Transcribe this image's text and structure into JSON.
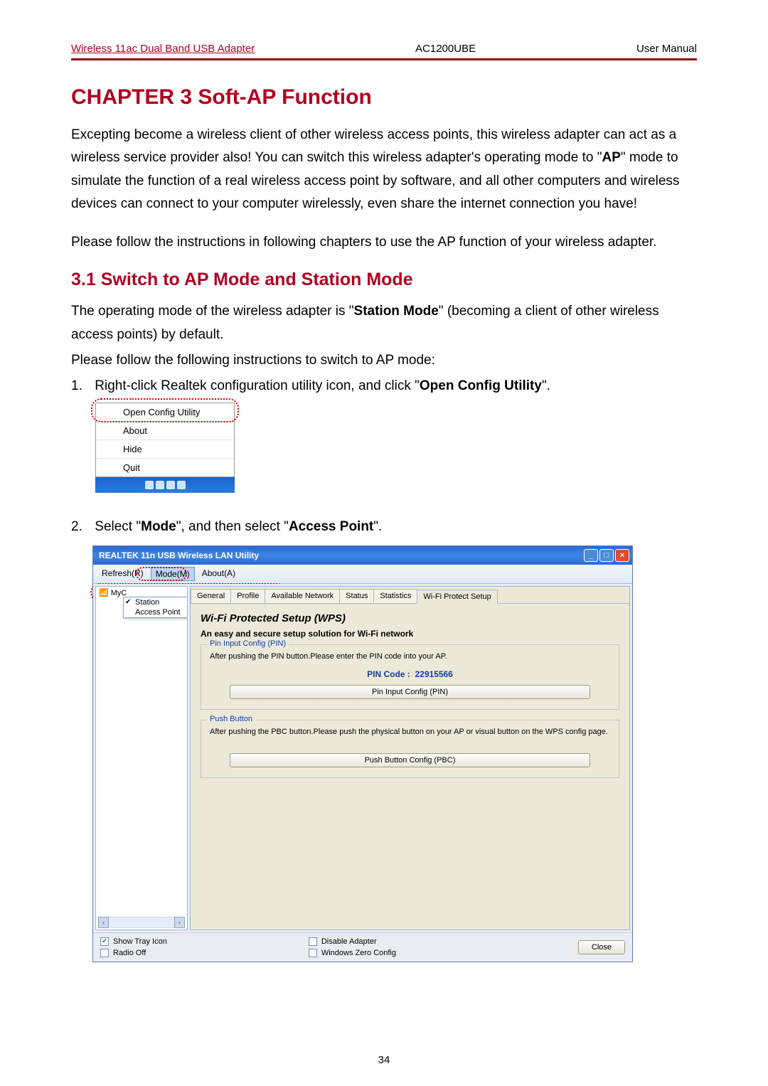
{
  "header": {
    "left": "Wireless 11ac Dual Band USB Adapter",
    "mid": "AC1200UBE",
    "right": "User Manual"
  },
  "chapter_title": "CHAPTER 3 Soft-AP Function",
  "intro1_pre": "Excepting become a wireless client of other wireless access points, this wireless adapter can act as a wireless service provider also! You can switch this wireless adapter's operating mode to \"",
  "intro1_bold": "AP",
  "intro1_post": "\" mode to simulate the function of a real wireless access point by software, and all other computers and wireless devices can connect to your computer wirelessly, even share the internet connection you have!",
  "intro2": "Please follow the instructions in following chapters to use the AP function of your wireless adapter.",
  "section_title": "3.1 Switch to AP Mode and Station Mode",
  "op1_pre": "The operating mode of the wireless adapter is \"",
  "op1_bold": "Station Mode",
  "op1_post": "\" (becoming a client of other wireless access points) by default.",
  "op2": "Please follow the following instructions to switch to AP mode:",
  "step1_num": "1.",
  "step1_pre": "Right-click Realtek configuration utility icon, and click \"",
  "step1_bold": "Open Config Utility",
  "step1_post": "\".",
  "ctx": {
    "open": "Open Config Utility",
    "about": "About",
    "hide": "Hide",
    "quit": "Quit"
  },
  "step2_num": "2.",
  "step2_pre": "Select \"",
  "step2_b1": "Mode",
  "step2_mid": "\", and then select \"",
  "step2_b2": "Access Point",
  "step2_post": "\".",
  "win": {
    "title": "REALTEK 11n USB Wireless LAN Utility",
    "menu": {
      "refresh": "Refresh(R)",
      "mode": "Mode(M)",
      "about": "About(A)"
    },
    "tree": {
      "root": "MyC",
      "station": "Station",
      "ap": "Access Point"
    },
    "tabs": {
      "general": "General",
      "profile": "Profile",
      "avail": "Available Network",
      "status": "Status",
      "stats": "Statistics",
      "wps": "Wi-Fi Protect Setup"
    },
    "wps": {
      "title": "Wi-Fi Protected Setup (WPS)",
      "subtitle": "An easy and secure setup solution for Wi-Fi network",
      "pin_legend": "Pin Input Config (PIN)",
      "pin_desc": "After pushing the PIN button.Please enter the PIN code into your AP.",
      "pin_label": "PIN Code :",
      "pin_value": "22915566",
      "pin_btn": "Pin Input Config (PIN)",
      "pbc_legend": "Push Button",
      "pbc_desc": "After pushing the PBC button.Please push the physical button on your AP or visual button on the WPS config page.",
      "pbc_btn": "Push Button Config (PBC)"
    },
    "footer": {
      "tray": "Show Tray Icon",
      "radio": "Radio Off",
      "disable": "Disable Adapter",
      "zero": "Windows Zero Config",
      "close": "Close"
    }
  },
  "page_number": "34"
}
